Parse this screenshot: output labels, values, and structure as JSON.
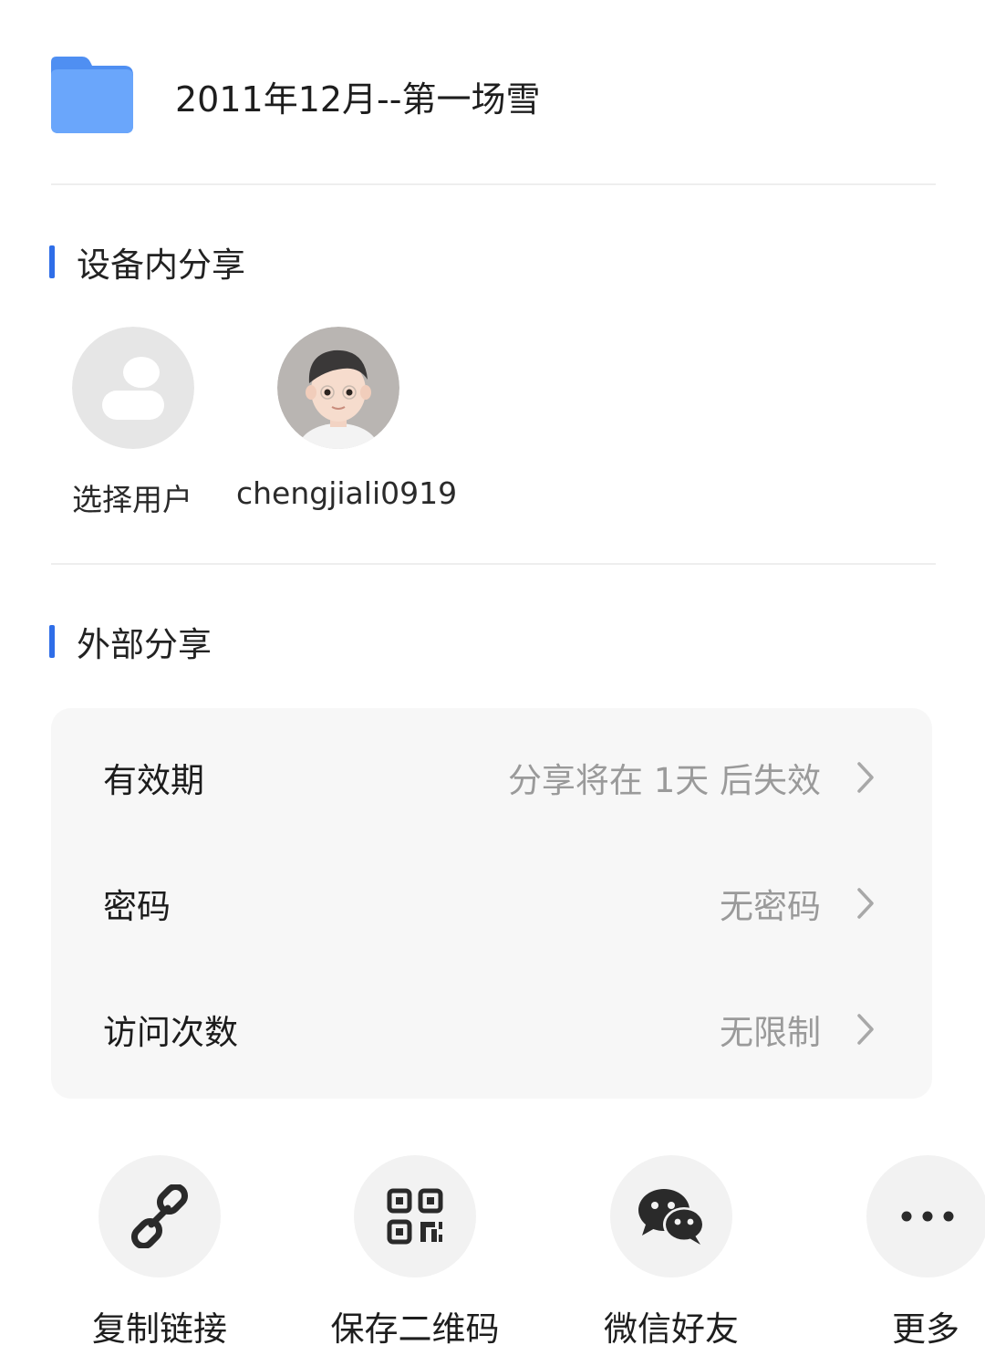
{
  "file": {
    "title": "2011年12月--第一场雪",
    "icon": "folder-icon"
  },
  "in_device_share": {
    "title": "设备内分享",
    "users": [
      {
        "label": "选择用户",
        "icon": "user-placeholder-icon"
      },
      {
        "label": "chengjiali0919",
        "icon": "avatar-3d-boy"
      }
    ]
  },
  "external_share": {
    "title": "外部分享",
    "settings": [
      {
        "label": "有效期",
        "value": "分享将在 1天 后失效"
      },
      {
        "label": "密码",
        "value": "无密码"
      },
      {
        "label": "访问次数",
        "value": "无限制"
      }
    ]
  },
  "actions": [
    {
      "label": "复制链接",
      "icon": "link-icon"
    },
    {
      "label": "保存二维码",
      "icon": "qr-code-icon"
    },
    {
      "label": "微信好友",
      "icon": "wechat-icon"
    },
    {
      "label": "更多",
      "icon": "more-icon"
    }
  ],
  "colors": {
    "accent": "#2f6ee8",
    "folder": "#5b9bf8",
    "card_bg": "#f7f7f7",
    "secondary_text": "#9a9a9a"
  }
}
